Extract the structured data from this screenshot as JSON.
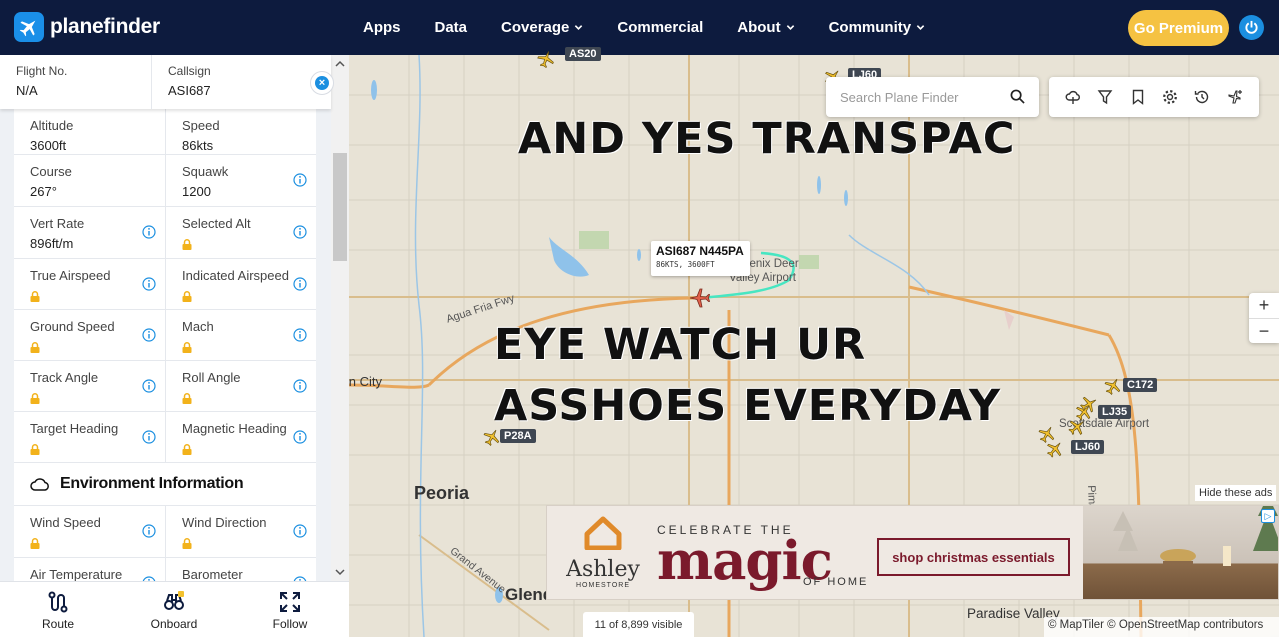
{
  "brand": {
    "name": "planefinder"
  },
  "nav": {
    "items": [
      {
        "label": "Apps",
        "dropdown": false
      },
      {
        "label": "Data",
        "dropdown": false
      },
      {
        "label": "Coverage",
        "dropdown": true
      },
      {
        "label": "Commercial",
        "dropdown": false
      },
      {
        "label": "About",
        "dropdown": true
      },
      {
        "label": "Community",
        "dropdown": true
      }
    ],
    "premium_label": "Go Premium"
  },
  "panel": {
    "flight_no": {
      "label": "Flight No.",
      "value": "N/A"
    },
    "callsign": {
      "label": "Callsign",
      "value": "ASI687"
    },
    "rows": [
      {
        "left": {
          "label": "Altitude",
          "value": "3600ft",
          "info": false,
          "locked": false
        },
        "right": {
          "label": "Speed",
          "value": "86kts",
          "info": false,
          "locked": false
        }
      },
      {
        "left": {
          "label": "Course",
          "value": "267°",
          "info": false,
          "locked": false
        },
        "right": {
          "label": "Squawk",
          "value": "1200",
          "info": true,
          "locked": false
        }
      },
      {
        "left": {
          "label": "Vert Rate",
          "value": "896ft/m",
          "info": true,
          "locked": false
        },
        "right": {
          "label": "Selected Alt",
          "value": "",
          "info": true,
          "locked": true
        }
      },
      {
        "left": {
          "label": "True Airspeed",
          "value": "",
          "info": true,
          "locked": true
        },
        "right": {
          "label": "Indicated Airspeed",
          "value": "",
          "info": true,
          "locked": true
        }
      },
      {
        "left": {
          "label": "Ground Speed",
          "value": "",
          "info": true,
          "locked": true
        },
        "right": {
          "label": "Mach",
          "value": "",
          "info": true,
          "locked": true
        }
      },
      {
        "left": {
          "label": "Track Angle",
          "value": "",
          "info": true,
          "locked": true
        },
        "right": {
          "label": "Roll Angle",
          "value": "",
          "info": true,
          "locked": true
        }
      },
      {
        "left": {
          "label": "Target Heading",
          "value": "",
          "info": true,
          "locked": true
        },
        "right": {
          "label": "Magnetic Heading",
          "value": "",
          "info": true,
          "locked": true
        }
      }
    ],
    "environment_title": "Environment Information",
    "env_rows": [
      {
        "left": {
          "label": "Wind Speed",
          "info": true,
          "locked": true
        },
        "right": {
          "label": "Wind Direction",
          "info": true,
          "locked": true
        }
      },
      {
        "left": {
          "label": "Air Temperature",
          "info": true,
          "locked": true
        },
        "right": {
          "label": "Barometer",
          "info": true,
          "locked": true
        }
      }
    ],
    "bottom_buttons": [
      {
        "label": "Route",
        "icon": "route-icon"
      },
      {
        "label": "Onboard",
        "icon": "binoculars-icon"
      },
      {
        "label": "Follow",
        "icon": "expand-icon"
      }
    ]
  },
  "map": {
    "search_placeholder": "Search Plane Finder",
    "tool_icons": [
      "weather-icon",
      "filter-icon",
      "bookmark-icon",
      "settings-icon",
      "history-icon",
      "add-plane-icon"
    ],
    "meme_line_1": "AND YES TRANSPAC",
    "meme_line_2": "EYE WATCH UR",
    "meme_line_3": "ASSHOES EVERYDAY",
    "selected_flight": {
      "title": "ASI687 N445PA",
      "subtitle": "86KTS, 3600FT"
    },
    "aircraft_tags": [
      "AS20",
      "LJ60",
      "C172",
      "LJ35",
      "LJ60",
      "P28A"
    ],
    "place_labels": [
      "Agua Fria Fwy",
      "Phoenix Deer Valley Airport",
      "Scottsdale Airport",
      "Pima Freeway",
      "Peoria",
      "Grand Avenue",
      "Glendale",
      "Paradise Valley",
      "Sun City"
    ],
    "visible_count": "11 of 8,899 visible",
    "attribution": "© MapTiler © OpenStreetMap contributors",
    "hide_ads": "Hide these ads",
    "zoom_in": "+",
    "zoom_out": "−"
  },
  "ad": {
    "brand": "Ashley",
    "brand_sub": "HOMESTORE",
    "celebrate": "CELEBRATE THE",
    "magic": "magic",
    "of_home": "OF HOME",
    "cta": "shop christmas essentials"
  },
  "colors": {
    "nav_bg": "#0d1b3e",
    "accent": "#1b8fe0",
    "premium": "#f5c242",
    "plane_yellow": "#f2c12e",
    "track": "#47e6c2",
    "ad_maroon": "#7b1a2c"
  }
}
